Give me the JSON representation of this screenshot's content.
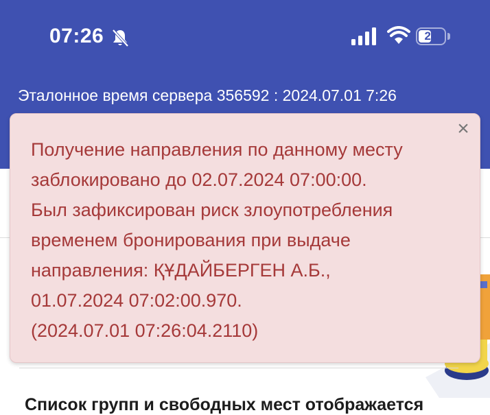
{
  "status_bar": {
    "time": "07:26",
    "battery": "21"
  },
  "header": {
    "server_time": "Эталонное время сервера 356592 : 2024.07.01 7:26"
  },
  "alert": {
    "close_label": "×",
    "lines": [
      "Получение направления по данному месту",
      "заблокировано до 02.07.2024 07:00:00.",
      "Был зафиксирован риск злоупотребления",
      "временем бронирования при выдаче",
      "направления: ҚҰДАЙБЕРГЕН А.Б.,",
      "01.07.2024 07:02:00.970.",
      "(2024.07.01 07:26:04.2110)"
    ]
  },
  "main": {
    "list_note": "Список групп и свободных мест отображается"
  },
  "colors": {
    "header_bg": "#3f51b1",
    "alert_bg": "#f4dedf",
    "alert_text": "#a53939"
  }
}
